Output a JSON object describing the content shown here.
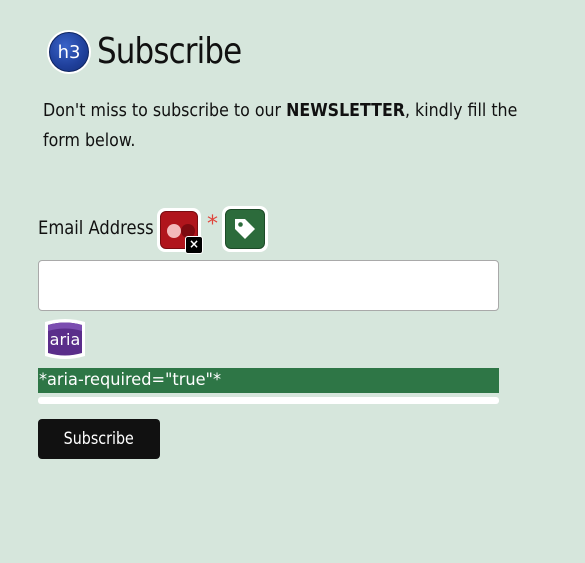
{
  "heading": {
    "badge_text": "h3",
    "title": "Subscribe"
  },
  "intro": {
    "text_before": "Don't miss to subscribe to our ",
    "text_bold": "NEWSLETTER",
    "text_after_line1": ", kindly fill the",
    "text_line2": "form below."
  },
  "form": {
    "email_label": "Email Address",
    "required_marker": "*",
    "email_value": "",
    "aria_badge_text": "aria",
    "aria_note": "*aria-required=\"true\"*",
    "submit_label": "Subscribe"
  },
  "icons": {
    "heading_badge": "h3-badge-icon",
    "missing_label_icon": "error-missing-label-icon",
    "tag_icon": "tag-icon",
    "aria_icon": "aria-icon"
  },
  "colors": {
    "background": "#d6e6dc",
    "aria_strip": "#2e7646",
    "required": "#e0453c",
    "button": "#111111"
  }
}
